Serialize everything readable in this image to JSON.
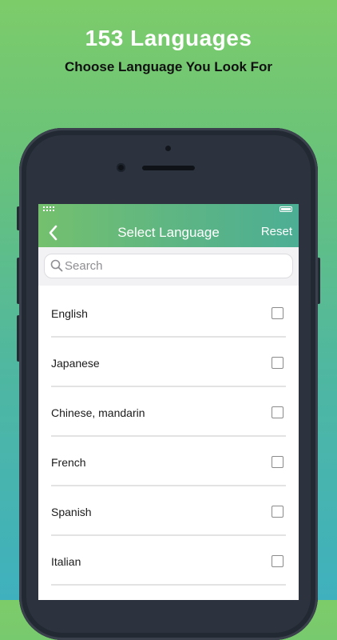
{
  "promo": {
    "title": "153 Languages",
    "subtitle": "Choose Language You Look For"
  },
  "header": {
    "back_icon": "chevron-left-icon",
    "title": "Select Language",
    "reset_label": "Reset"
  },
  "search": {
    "icon": "search-icon",
    "placeholder": "Search",
    "value": ""
  },
  "languages": [
    {
      "name": "English",
      "checked": false
    },
    {
      "name": "Japanese",
      "checked": false
    },
    {
      "name": "Chinese, mandarin",
      "checked": false
    },
    {
      "name": "French",
      "checked": false
    },
    {
      "name": "Spanish",
      "checked": false
    },
    {
      "name": "Italian",
      "checked": false
    }
  ],
  "colors": {
    "header_gradient_start": "#74c06e",
    "header_gradient_end": "#4cae94",
    "background_top": "#7dcc6a",
    "background_bottom": "#3fb1be",
    "phone_body": "#2c333e"
  }
}
